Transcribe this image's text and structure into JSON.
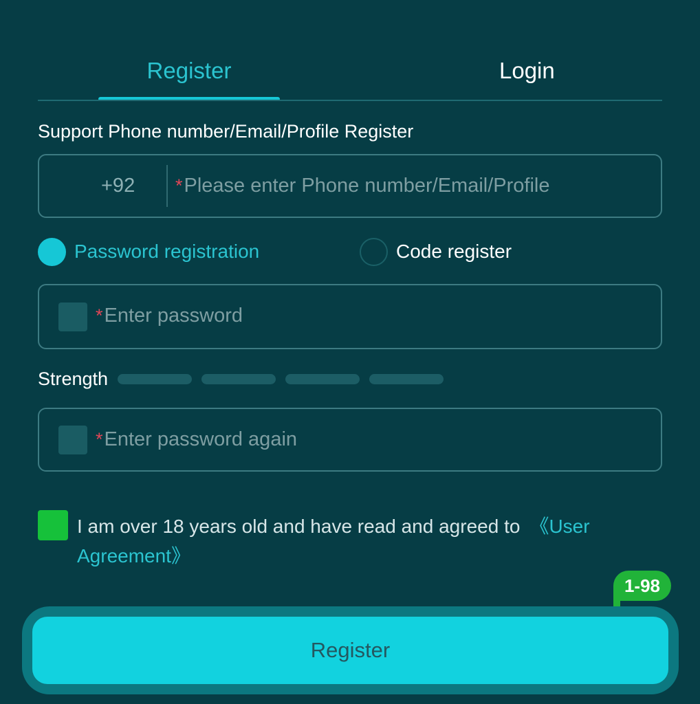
{
  "tabs": {
    "register": "Register",
    "login": "Login"
  },
  "form": {
    "support_label": "Support Phone number/Email/Profile Register",
    "country_code": "+92",
    "required_mark": "*",
    "phone_placeholder": "Please enter Phone number/Email/Profile",
    "radio_password": "Password registration",
    "radio_code": "Code register",
    "password_placeholder": "Enter password",
    "strength_label": "Strength",
    "password_again_placeholder": "Enter password again"
  },
  "agreement": {
    "text": "I am over 18 years old and have read and agreed to",
    "link": "《User Agreement》"
  },
  "badge": "1-98",
  "submit_label": "Register",
  "colors": {
    "background": "#063d45",
    "accent": "#16c7d6",
    "check": "#16c13a",
    "badge": "#21b339",
    "required": "#e04657"
  }
}
